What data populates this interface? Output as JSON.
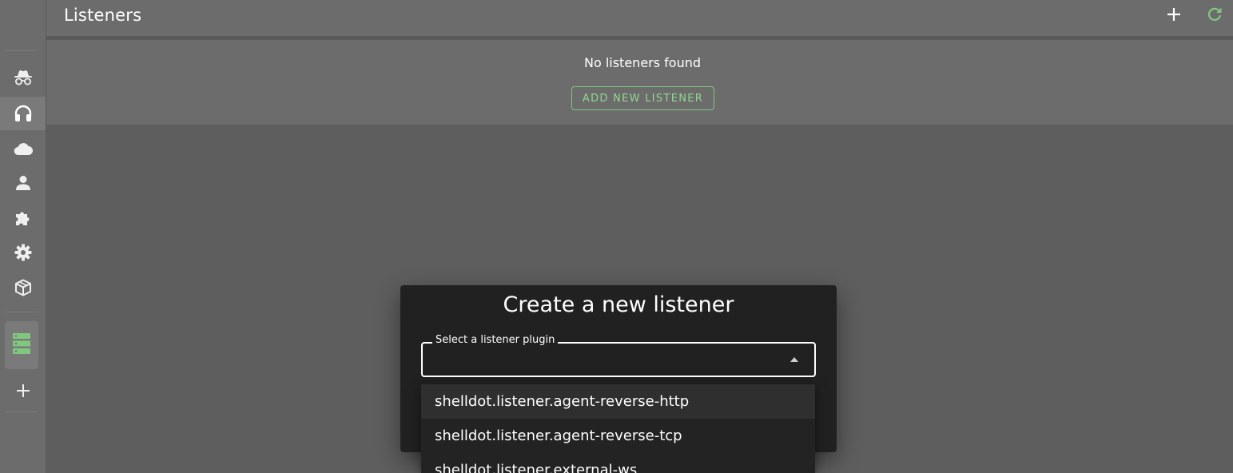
{
  "header": {
    "title": "Listeners",
    "add_icon": "plus-icon",
    "refresh_icon": "refresh-icon"
  },
  "sidebar": {
    "items": [
      {
        "name": "incognito-icon"
      },
      {
        "name": "headset-icon",
        "active": true
      },
      {
        "name": "cloud-icon"
      },
      {
        "name": "user-icon"
      },
      {
        "name": "puzzle-icon"
      },
      {
        "name": "gear-icon"
      },
      {
        "name": "package-icon"
      },
      {
        "name": "server-icon"
      },
      {
        "name": "plus-icon"
      }
    ]
  },
  "empty_state": {
    "message": "No listeners found",
    "button_label": "ADD NEW LISTENER"
  },
  "dialog": {
    "title": "Create a new listener",
    "select_label": "Select a listener plugin",
    "select_value": "",
    "options": [
      "shelldot.listener.agent-reverse-http",
      "shelldot.listener.agent-reverse-tcp",
      "shelldot.listener.external-ws"
    ]
  },
  "colors": {
    "accent_green": "#7fc97f",
    "sidebar_bg": "#6c6c6c",
    "backdrop": "#5e5e5e",
    "dialog_bg": "#212121"
  }
}
